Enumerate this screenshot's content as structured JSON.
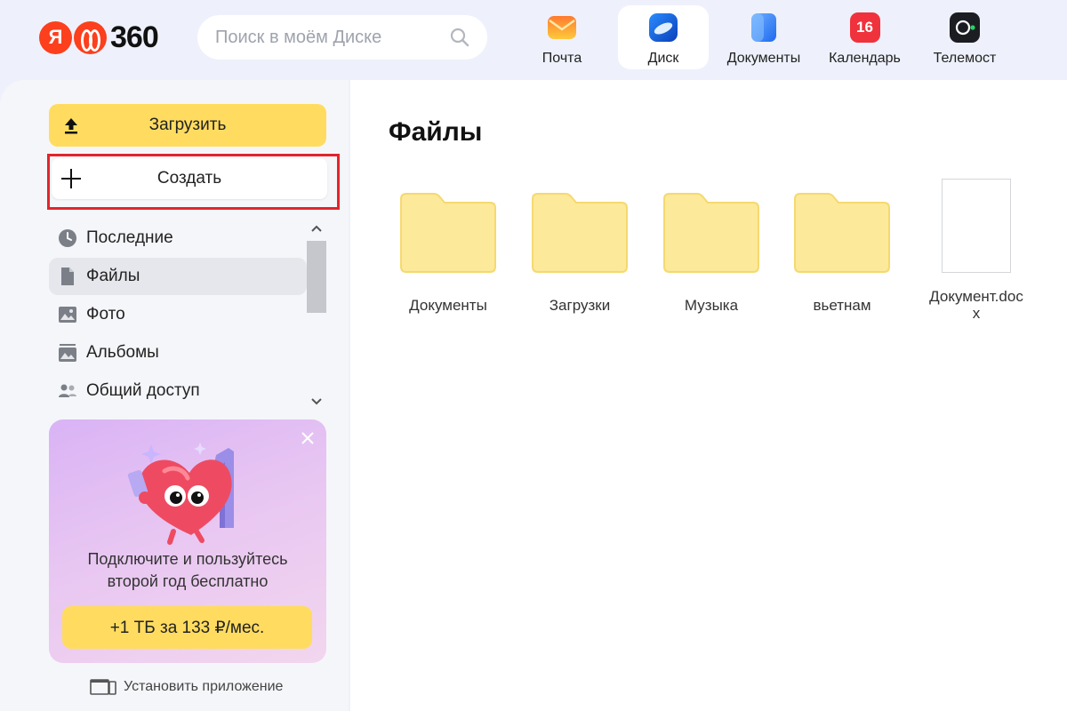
{
  "header": {
    "logo_ya": "Я",
    "logo_text": "360",
    "search_placeholder": "Поиск в моём Диске",
    "services": [
      {
        "label": "Почта",
        "icon": "mail-icon"
      },
      {
        "label": "Диск",
        "icon": "disk-icon",
        "active": true
      },
      {
        "label": "Документы",
        "icon": "documents-icon"
      },
      {
        "label": "Календарь",
        "icon": "calendar-icon",
        "badge": "16"
      },
      {
        "label": "Телемост",
        "icon": "telemost-icon"
      }
    ]
  },
  "sidebar": {
    "upload_label": "Загрузить",
    "create_label": "Создать",
    "nav": [
      {
        "label": "Последние",
        "icon": "clock-icon"
      },
      {
        "label": "Файлы",
        "icon": "file-icon",
        "active": true
      },
      {
        "label": "Фото",
        "icon": "photo-icon"
      },
      {
        "label": "Альбомы",
        "icon": "album-icon"
      },
      {
        "label": "Общий доступ",
        "icon": "people-icon"
      }
    ],
    "promo": {
      "text_line1": "Подключите и пользуйтесь",
      "text_line2": "второй год бесплатно",
      "button_label": "+1 ТБ за 133 ₽/мес."
    },
    "install_label": "Установить приложение"
  },
  "main": {
    "title": "Файлы",
    "files": [
      {
        "name": "Документы",
        "type": "folder"
      },
      {
        "name": "Загрузки",
        "type": "folder"
      },
      {
        "name": "Музыка",
        "type": "folder"
      },
      {
        "name": "вьетнам",
        "type": "folder"
      },
      {
        "name": "Документ.docx",
        "type": "docx"
      }
    ]
  },
  "colors": {
    "accent_yellow": "#ffdc60",
    "brand_red": "#fc3f1d",
    "highlight_red": "#e3242b",
    "folder_fill": "#fde99a",
    "folder_stroke": "#f5d970"
  }
}
